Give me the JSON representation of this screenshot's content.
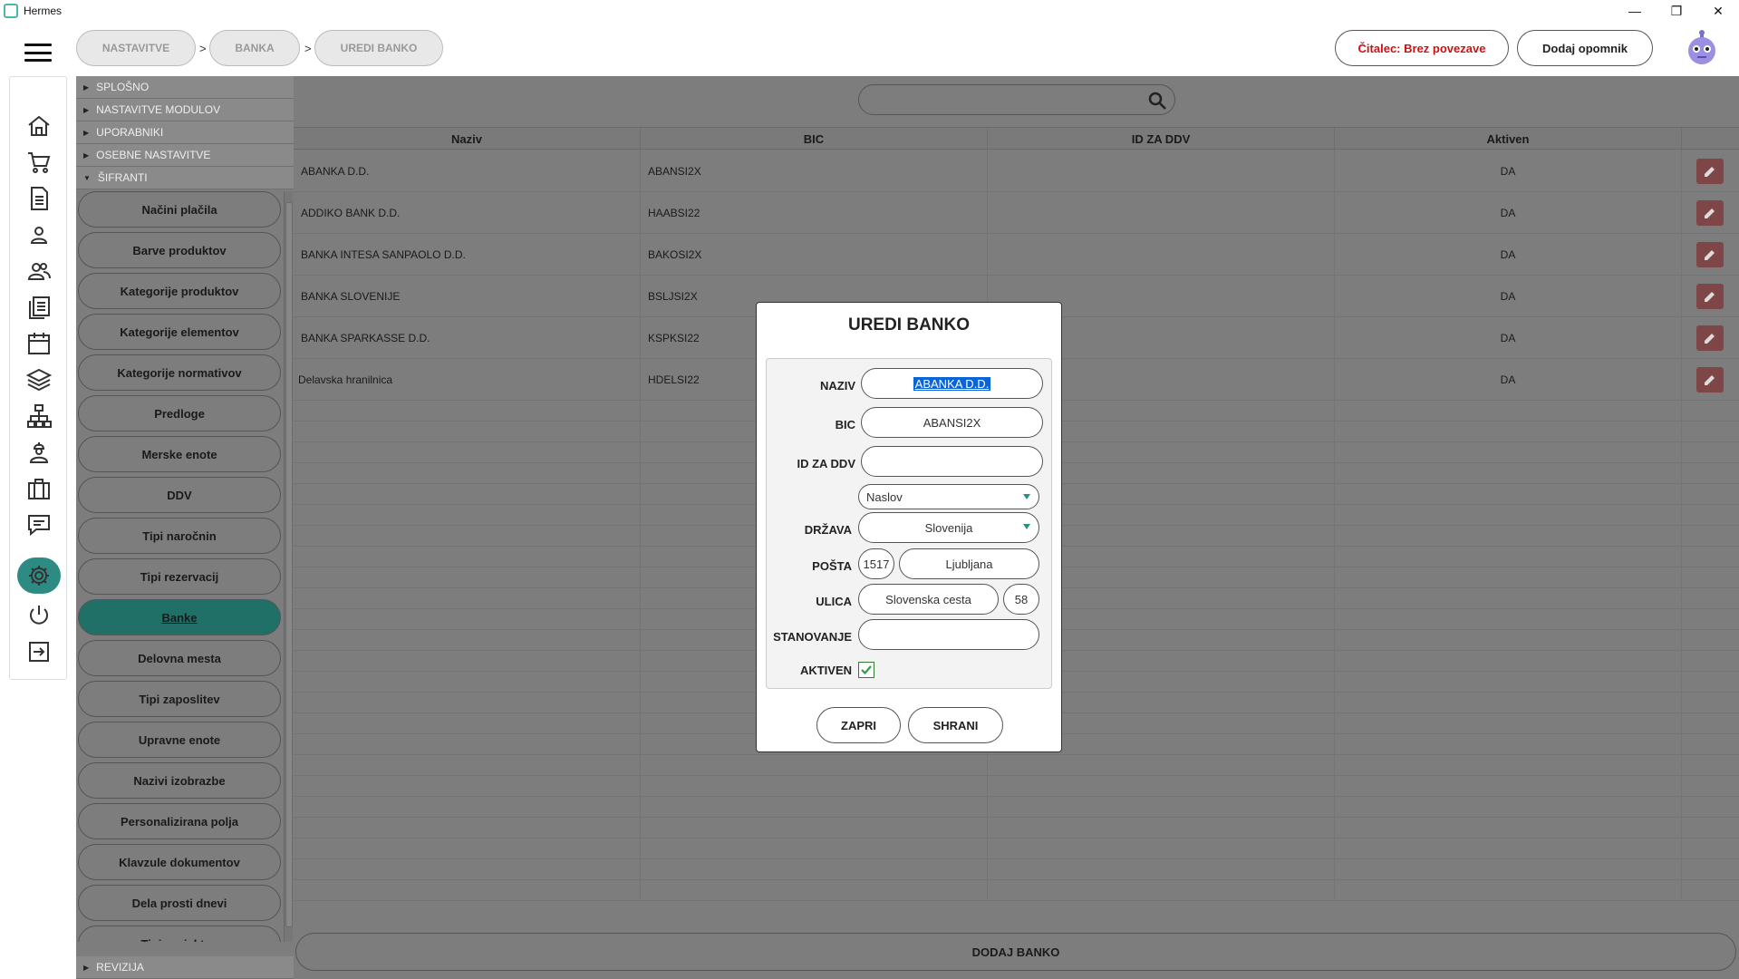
{
  "window": {
    "title": "Hermes",
    "controls": [
      "minimize-icon",
      "restore-icon",
      "close-icon"
    ]
  },
  "header": {
    "breadcrumb": [
      "NASTAVITVE",
      "BANKA",
      "UREDI BANKO"
    ],
    "separator": ">",
    "reader_button": "Čitalec: Brez povezave",
    "reminder_button": "Dodaj opomnik"
  },
  "rail": {
    "icons": [
      "home-icon",
      "cart-icon",
      "document-icon",
      "user-icon",
      "users-icon",
      "notes-icon",
      "calendar-icon",
      "layers-icon",
      "hierarchy-icon",
      "worker-icon",
      "briefcase-icon",
      "chat-icon",
      "gear-icon",
      "power-icon",
      "logout-icon"
    ],
    "active": "gear-icon"
  },
  "tree": {
    "sections": [
      "SPLOŠNO",
      "NASTAVITVE MODULOV",
      "UPORABNIKI",
      "OSEBNE NASTAVITVE",
      "ŠIFRANTI"
    ],
    "items": [
      "Načini plačila",
      "Barve produktov",
      "Kategorije produktov",
      "Kategorije elementov",
      "Kategorije normativov",
      "Predloge",
      "Merske enote",
      "DDV",
      "Tipi naročnin",
      "Tipi rezervacij",
      "Banke",
      "Delovna mesta",
      "Tipi zaposlitev",
      "Upravne enote",
      "Nazivi izobrazbe",
      "Personalizirana polja",
      "Klavzule dokumentov",
      "Dela prosti dnevi",
      "Tipi projektov"
    ],
    "active_item": "Banke",
    "footer_section": "REVIZIJA"
  },
  "table": {
    "columns": [
      "Naziv",
      "BIC",
      "ID ZA DDV",
      "Aktiven"
    ],
    "rows": [
      {
        "naziv": "ABANKA D.D.",
        "bic": "ABANSI2X",
        "ddv": "",
        "aktiven": "DA"
      },
      {
        "naziv": "ADDIKO BANK D.D.",
        "bic": "HAABSI22",
        "ddv": "",
        "aktiven": "DA"
      },
      {
        "naziv": "BANKA INTESA SANPAOLO D.D.",
        "bic": "BAKOSI2X",
        "ddv": "",
        "aktiven": "DA"
      },
      {
        "naziv": "BANKA SLOVENIJE",
        "bic": "BSLJSI2X",
        "ddv": "",
        "aktiven": "DA"
      },
      {
        "naziv": "BANKA SPARKASSE D.D.",
        "bic": "KSPKSI22",
        "ddv": "",
        "aktiven": "DA"
      },
      {
        "naziv": "Delavska hranilnica",
        "bic": "HDELSI22",
        "ddv": "",
        "aktiven": "DA"
      }
    ],
    "add_button": "DODAJ BANKO"
  },
  "modal": {
    "title": "UREDI BANKO",
    "labels": {
      "naziv": "NAZIV",
      "bic": "BIC",
      "ddv": "ID ZA DDV",
      "drzava": "DRŽAVA",
      "posta": "POŠTA",
      "ulica": "ULICA",
      "stanovanje": "STANOVANJE",
      "aktiven": "AKTIVEN"
    },
    "values": {
      "naziv": "ABANKA D.D.",
      "bic": "ABANSI2X",
      "ddv": "",
      "naslov": "Naslov",
      "drzava": "Slovenija",
      "postna_st": "1517",
      "kraj": "Ljubljana",
      "ulica": "Slovenska cesta",
      "hisna_st": "58",
      "stanovanje": "",
      "aktiven": true
    },
    "close_button": "ZAPRI",
    "save_button": "SHRANI"
  },
  "colors": {
    "accent": "#217068",
    "edit_button": "#7e4646",
    "reader_text": "#cc1111",
    "selection": "#0a64d8"
  }
}
